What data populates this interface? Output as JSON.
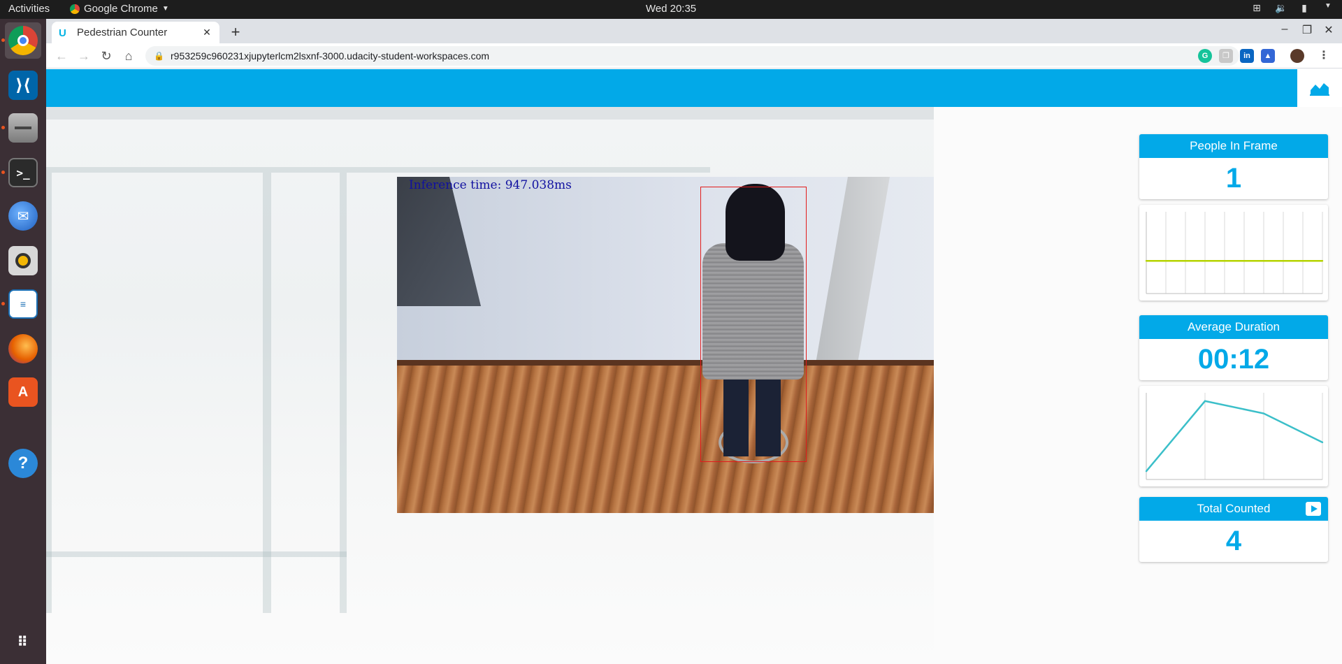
{
  "topbar": {
    "activities": "Activities",
    "app_name": "Google Chrome",
    "clock": "Wed 20:35"
  },
  "dock": {
    "items": [
      {
        "name": "chrome",
        "color": "#e8eaed"
      },
      {
        "name": "vscode",
        "color": "#0065a9"
      },
      {
        "name": "files",
        "color": "#8a8a8a"
      },
      {
        "name": "terminal",
        "color": "#2b2b2b"
      },
      {
        "name": "thunderbird",
        "color": "#2f78d0"
      },
      {
        "name": "rhythmbox",
        "color": "#d8d8d8"
      },
      {
        "name": "libreoffice-writer",
        "color": "#1a6fb4"
      },
      {
        "name": "firefox",
        "color": "#e66000"
      },
      {
        "name": "software-center",
        "color": "#e95420"
      },
      {
        "name": "help",
        "color": "#2b88d8"
      }
    ]
  },
  "browser": {
    "tab_title": "Pedestrian Counter",
    "url": "r953259c960231xjupyterlcm2lsxnf-3000.udacity-student-workspaces.com"
  },
  "video": {
    "inference_text": "Inference time: 947.038ms"
  },
  "stats": {
    "people_in_frame_label": "People In Frame",
    "people_in_frame_value": "1",
    "average_duration_label": "Average Duration",
    "average_duration_value": "00:12",
    "total_counted_label": "Total Counted",
    "total_counted_value": "4"
  },
  "colors": {
    "accent": "#02a9e8",
    "people_line": "#b5d300",
    "duration_line": "#3bbfc9"
  },
  "chart_data": [
    {
      "type": "line",
      "name": "people-in-frame",
      "x": [
        0,
        1,
        2,
        3,
        4,
        5,
        6,
        7,
        8
      ],
      "y": [
        1,
        1,
        1,
        1,
        1,
        1,
        1,
        1,
        1
      ],
      "ylim": [
        0,
        2.5
      ],
      "grid": true
    },
    {
      "type": "line",
      "name": "average-duration",
      "x": [
        0,
        3,
        6,
        9
      ],
      "y": [
        0.1,
        0.95,
        0.8,
        0.45
      ],
      "ylim": [
        0,
        1.05
      ],
      "grid": true
    }
  ]
}
